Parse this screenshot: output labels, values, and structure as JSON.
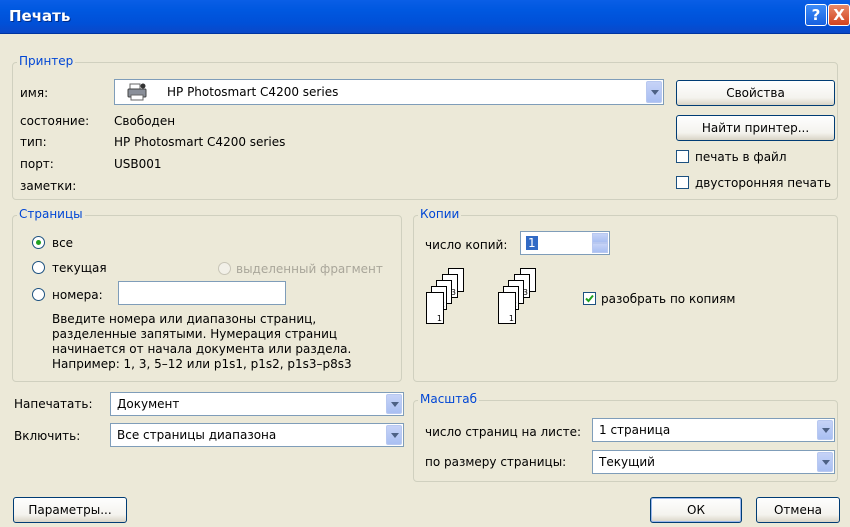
{
  "window": {
    "title": "Печать",
    "help_label": "?",
    "close_label": "X"
  },
  "printer": {
    "legend": "Принтер",
    "name_label": "имя:",
    "name_value": "HP Photosmart C4200 series",
    "status_label": "состояние:",
    "status_value": "Свободен",
    "type_label": "тип:",
    "type_value": "HP Photosmart C4200 series",
    "port_label": "порт:",
    "port_value": "USB001",
    "notes_label": "заметки:",
    "properties_button": "Свойства",
    "find_button": "Найти принтер...",
    "print_to_file": "печать в файл",
    "duplex": "двусторонняя печать"
  },
  "pages": {
    "legend": "Страницы",
    "all": "все",
    "current": "текущая",
    "selection": "выделенный фрагмент",
    "numbers": "номера:",
    "hint": [
      "Введите номера или диапазоны страниц,",
      "разделенные запятыми. Нумерация страниц",
      "начинается от начала документа или раздела.",
      "Например: 1, 3, 5–12 или p1s1, p1s2, p1s3–p8s3"
    ]
  },
  "copies": {
    "legend": "Копии",
    "count_label": "число копий:",
    "count_value": "1",
    "collate": "разобрать по копиям",
    "stack_labels": [
      "3",
      "2",
      "1"
    ]
  },
  "print_what": {
    "label": "Напечатать:",
    "value": "Документ"
  },
  "include": {
    "label": "Включить:",
    "value": "Все страницы диапазона"
  },
  "scale": {
    "legend": "Масштаб",
    "per_sheet_label": "число страниц на листе:",
    "per_sheet_value": "1 страница",
    "fit_label": "по размеру страницы:",
    "fit_value": "Текущий"
  },
  "footer": {
    "options_button": "Параметры...",
    "ok_button": "ОК",
    "cancel_button": "Отмена"
  }
}
